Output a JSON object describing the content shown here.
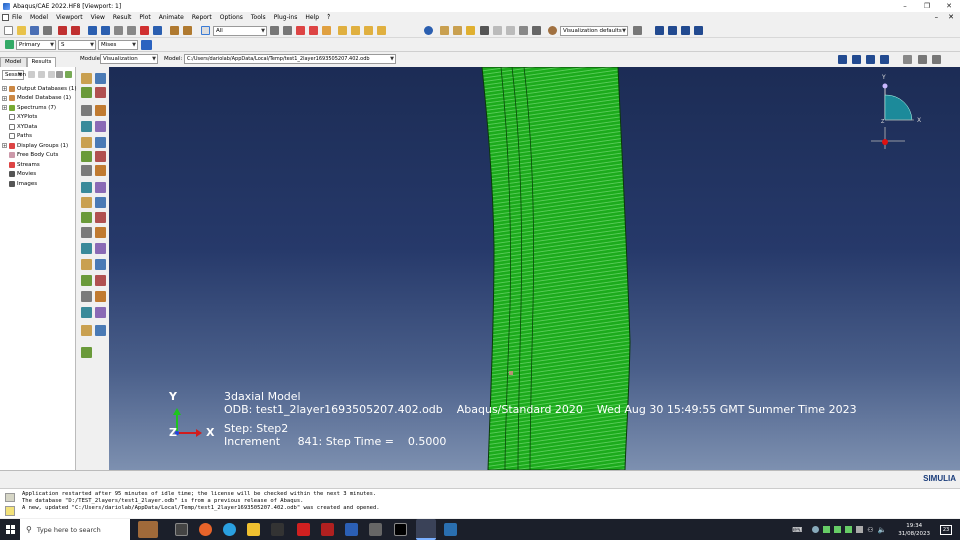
{
  "window": {
    "title": "Abaqus/CAE 2022.HF8 [Viewport: 1]",
    "minimize": "–",
    "maximize": "❐",
    "close": "✕"
  },
  "menu": {
    "items": [
      "File",
      "Model",
      "Viewport",
      "View",
      "Result",
      "Plot",
      "Animate",
      "Report",
      "Options",
      "Tools",
      "Plug-ins",
      "Help"
    ],
    "help_arrow": "?̂"
  },
  "toolbar": {
    "selection_filter": "All",
    "visualization_defaults": "Visualization defaults"
  },
  "toolbar2": {
    "primary": "Primary",
    "s": "S",
    "mises": "Mises"
  },
  "context": {
    "module_label": "Module:",
    "module_value": "Visualization",
    "model_label": "Model:",
    "model_value": "C:/Users/dariolab/AppData/Local/Temp/test1_2layer1693505207.402.odb"
  },
  "left_tabs": {
    "model": "Model",
    "results": "Results"
  },
  "session_combo": "Session",
  "tree": [
    {
      "label": "Output Databases (1)",
      "expand": "+"
    },
    {
      "label": "Model Database (1)",
      "expand": "+"
    },
    {
      "label": "Spectrums (7)",
      "expand": "+"
    },
    {
      "label": "XYPlots",
      "expand": ""
    },
    {
      "label": "XYData",
      "expand": ""
    },
    {
      "label": "Paths",
      "expand": ""
    },
    {
      "label": "Display Groups (1)",
      "expand": "+"
    },
    {
      "label": "Free Body Cuts",
      "expand": ""
    },
    {
      "label": "Streams",
      "expand": ""
    },
    {
      "label": "Movies",
      "expand": ""
    },
    {
      "label": "Images",
      "expand": ""
    }
  ],
  "viewport_info": {
    "title": "3daxial Model",
    "odb_line": "ODB: test1_2layer1693505207.402.odb    Abaqus/Standard 2020    Wed Aug 30 15:49:55 GMT Summer Time 2023",
    "step_line": "Step: Step2",
    "increment_line": "Increment     841: Step Time =    0.5000"
  },
  "triad": {
    "y": "Y",
    "z": "Z",
    "x": "X"
  },
  "view_cube": {
    "y": "Y",
    "x": "X",
    "z": "Z"
  },
  "brand": "SIMULIA",
  "messages": [
    "Application restarted after 95 minutes of idle time; the license will be checked within the next 3 minutes.",
    "The database \"D:/TEST_2layers/test1_2layer.odb\" is from a previous release of Abaqus.",
    "A new, updated \"C:/Users/dariolab/AppData/Local/Temp/test1_2layer1693505207.402.odb\" was created and opened."
  ],
  "taskbar": {
    "search_placeholder": "Type here to search",
    "time": "19:34",
    "date": "31/08/2023",
    "notif": "23"
  },
  "colors": {
    "model_green": "#1fae1f",
    "background_top": "#1c2c55",
    "background_bottom": "#7d90b0"
  }
}
